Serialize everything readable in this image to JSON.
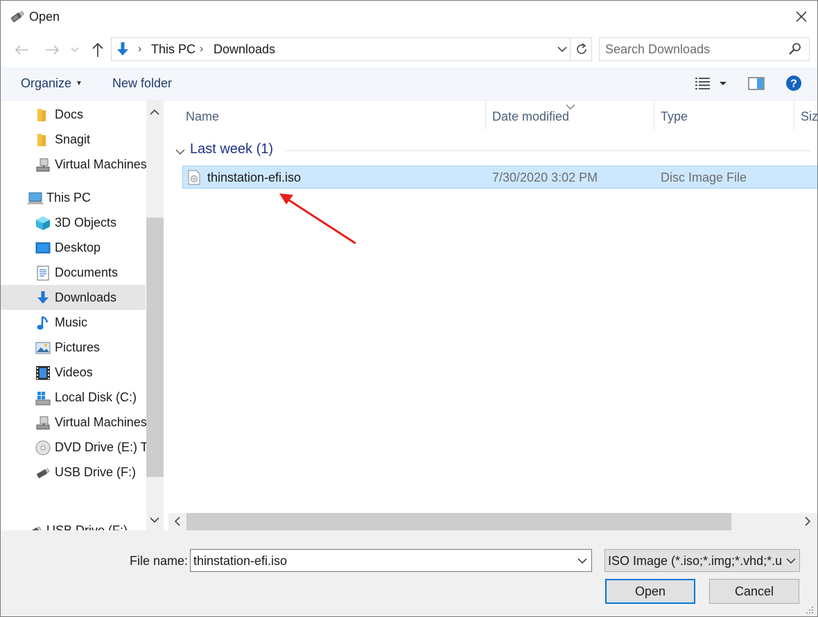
{
  "window": {
    "title": "Open",
    "icon": "usb-drive-icon"
  },
  "address": {
    "crumbs": [
      "This PC",
      "Downloads"
    ]
  },
  "search": {
    "placeholder": "Search Downloads"
  },
  "toolbar": {
    "organize_label": "Organize",
    "new_folder_label": "New folder"
  },
  "sidebar": {
    "items": [
      {
        "label": "Docs",
        "icon": "folder-icon"
      },
      {
        "label": "Snagit",
        "icon": "folder-icon"
      },
      {
        "label": "Virtual Machines",
        "icon": "network-drive-icon"
      },
      {
        "label": "This PC",
        "icon": "computer-icon"
      },
      {
        "label": "3D Objects",
        "icon": "cube-icon"
      },
      {
        "label": "Desktop",
        "icon": "desktop-icon"
      },
      {
        "label": "Documents",
        "icon": "documents-icon"
      },
      {
        "label": "Downloads",
        "icon": "download-icon",
        "selected": true
      },
      {
        "label": "Music",
        "icon": "music-icon"
      },
      {
        "label": "Pictures",
        "icon": "pictures-icon"
      },
      {
        "label": "Videos",
        "icon": "videos-icon"
      },
      {
        "label": "Local Disk (C:)",
        "icon": "local-disk-icon"
      },
      {
        "label": "Virtual Machines",
        "icon": "network-drive-icon"
      },
      {
        "label": "DVD Drive (E:) Th",
        "icon": "dvd-drive-icon"
      },
      {
        "label": "USB Drive (F:)",
        "icon": "usb-drive-icon"
      },
      {
        "label": "USB Drive (F:)",
        "icon": "usb-drive-icon"
      }
    ]
  },
  "columns": {
    "name": "Name",
    "date": "Date modified",
    "type": "Type",
    "size": "Size"
  },
  "group": {
    "label": "Last week (1)"
  },
  "files": [
    {
      "name": "thinstation-efi.iso",
      "date": "7/30/2020 3:02 PM",
      "type": "Disc Image File",
      "icon": "disc-image-file-icon",
      "selected": true
    }
  ],
  "bottom": {
    "filename_label": "File name:",
    "filename_value": "thinstation-efi.iso",
    "filetype_value": "ISO Image (*.iso;*.img;*.vhd;*.u",
    "open_label": "Open",
    "cancel_label": "Cancel"
  },
  "colors": {
    "accent": "#0078d7",
    "selection": "#cce8ff",
    "annotation": "#e8201a"
  }
}
